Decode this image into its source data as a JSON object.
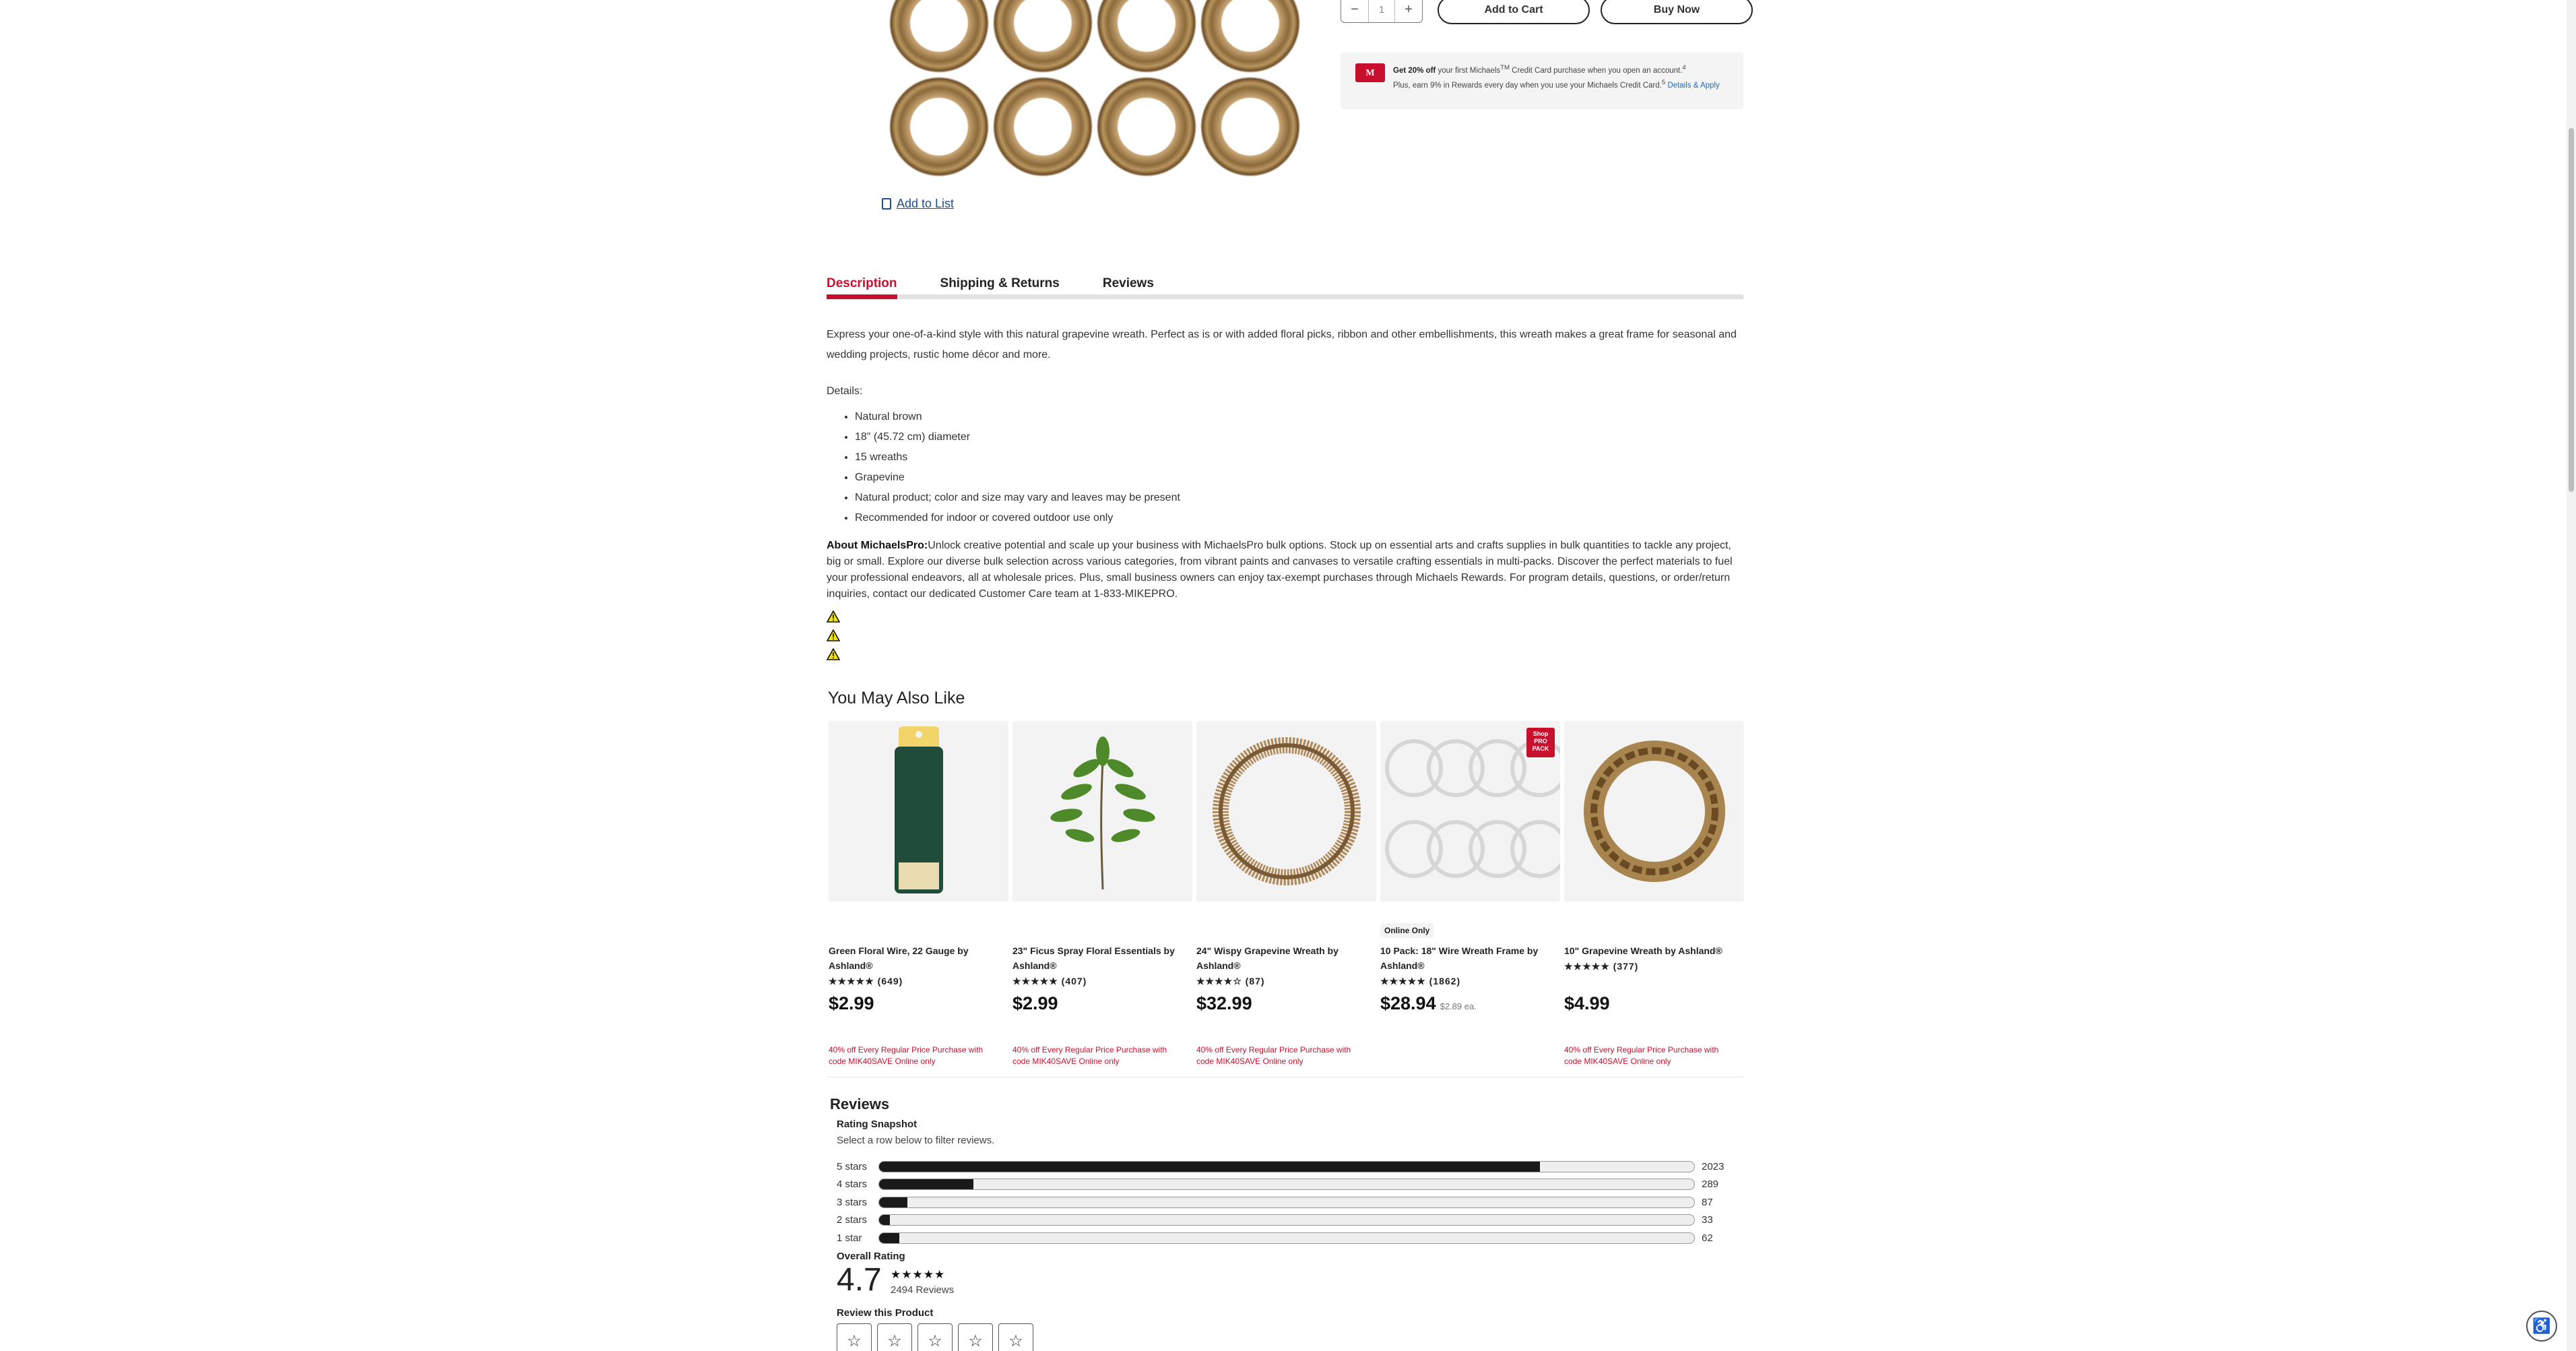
{
  "purchase": {
    "qty_minus": "−",
    "qty_value": "1",
    "qty_plus": "+",
    "add_to_cart": "Add to Cart",
    "buy_now": "Buy Now"
  },
  "promo": {
    "card_logo": "M",
    "bold": "Get 20% off",
    "text1": " your first Michaels",
    "tm": "TM",
    "text2": " Credit Card purchase when you open an account.",
    "sup4": "4",
    "text3": "Plus, earn 9% in Rewards every day when you use your Michaels Credit Card.",
    "sup5": "5",
    "link": "Details & Apply"
  },
  "add_to_list": "Add to List",
  "tabs": {
    "description": "Description",
    "shipping": "Shipping & Returns",
    "reviews": "Reviews"
  },
  "description": {
    "intro": "Express your one-of-a-kind style with this natural grapevine wreath. Perfect as is or with added floral picks, ribbon and other embellishments, this wreath makes a great frame for seasonal and wedding projects, rustic home décor and more.",
    "details_label": "Details:",
    "details": [
      "Natural brown",
      "18\" (45.72 cm) diameter",
      "15 wreaths",
      "Grapevine",
      "Natural product; color and size may vary and leaves may be present",
      "Recommended for indoor or covered outdoor use only"
    ],
    "about_label": "About MichaelsPro:",
    "about_text": "Unlock creative potential and scale up your business with MichaelsPro bulk options. Stock up on essential arts and crafts supplies in bulk quantities to tackle any project, big or small. Explore our diverse bulk selection across various categories, from vibrant paints and canvases to versatile crafting essentials in multi-packs. Discover the perfect materials to fuel your professional endeavors, all at wholesale prices. Plus, small business owners can enjoy tax-exempt purchases through Michaels Rewards. For program details, questions, or order/return inquiries, contact our dedicated Customer Care team at 1-833-MIKEPRO."
  },
  "ymal": {
    "title": "You May Also Like",
    "products": [
      {
        "name": "Green Floral Wire, 22 Gauge by Ashland®",
        "stars": "★★★★★",
        "count": "(649)",
        "price": "$2.99",
        "unit": "",
        "badge": "",
        "promo": "40% off Every Regular Price Purchase with code MIK40SAVE Online only"
      },
      {
        "name": "23\" Ficus Spray Floral Essentials by Ashland®",
        "stars": "★★★★★",
        "count": "(407)",
        "price": "$2.99",
        "unit": "",
        "badge": "",
        "promo": "40% off Every Regular Price Purchase with code MIK40SAVE Online only"
      },
      {
        "name": "24\" Wispy Grapevine Wreath by Ashland®",
        "stars": "★★★★☆",
        "count": "(87)",
        "price": "$32.99",
        "unit": "",
        "badge": "",
        "promo": "40% off Every Regular Price Purchase with code MIK40SAVE Online only"
      },
      {
        "name": "10 Pack: 18\" Wire Wreath Frame by Ashland®",
        "stars": "★★★★★",
        "count": "(1862)",
        "price": "$28.94",
        "unit": "$2.89 ea.",
        "badge": "Online Only",
        "pro_pack": "Shop PRO PACK",
        "promo": ""
      },
      {
        "name": "10\" Grapevine Wreath by Ashland®",
        "stars": "★★★★★",
        "count": "(377)",
        "price": "$4.99",
        "unit": "",
        "badge": "",
        "promo": "40% off Every Regular Price Purchase with code MIK40SAVE Online only"
      }
    ]
  },
  "reviews": {
    "heading": "Reviews",
    "snapshot": "Rating Snapshot",
    "snapshot_sub": "Select a row below to filter reviews.",
    "rows": [
      {
        "label": "5 stars",
        "count": "2023",
        "fraction": 0.811
      },
      {
        "label": "4 stars",
        "count": "289",
        "fraction": 0.116
      },
      {
        "label": "3 stars",
        "count": "87",
        "fraction": 0.035
      },
      {
        "label": "2 stars",
        "count": "33",
        "fraction": 0.013
      },
      {
        "label": "1 star",
        "count": "62",
        "fraction": 0.025
      }
    ],
    "overall_label": "Overall Rating",
    "overall_value": "4.7",
    "overall_stars": "★★★★★",
    "overall_count": "2494 Reviews",
    "review_this": "Review this Product",
    "star_button": "☆"
  },
  "colors": {
    "brand_red": "#c8102e",
    "link_blue": "#1f4f8c"
  }
}
